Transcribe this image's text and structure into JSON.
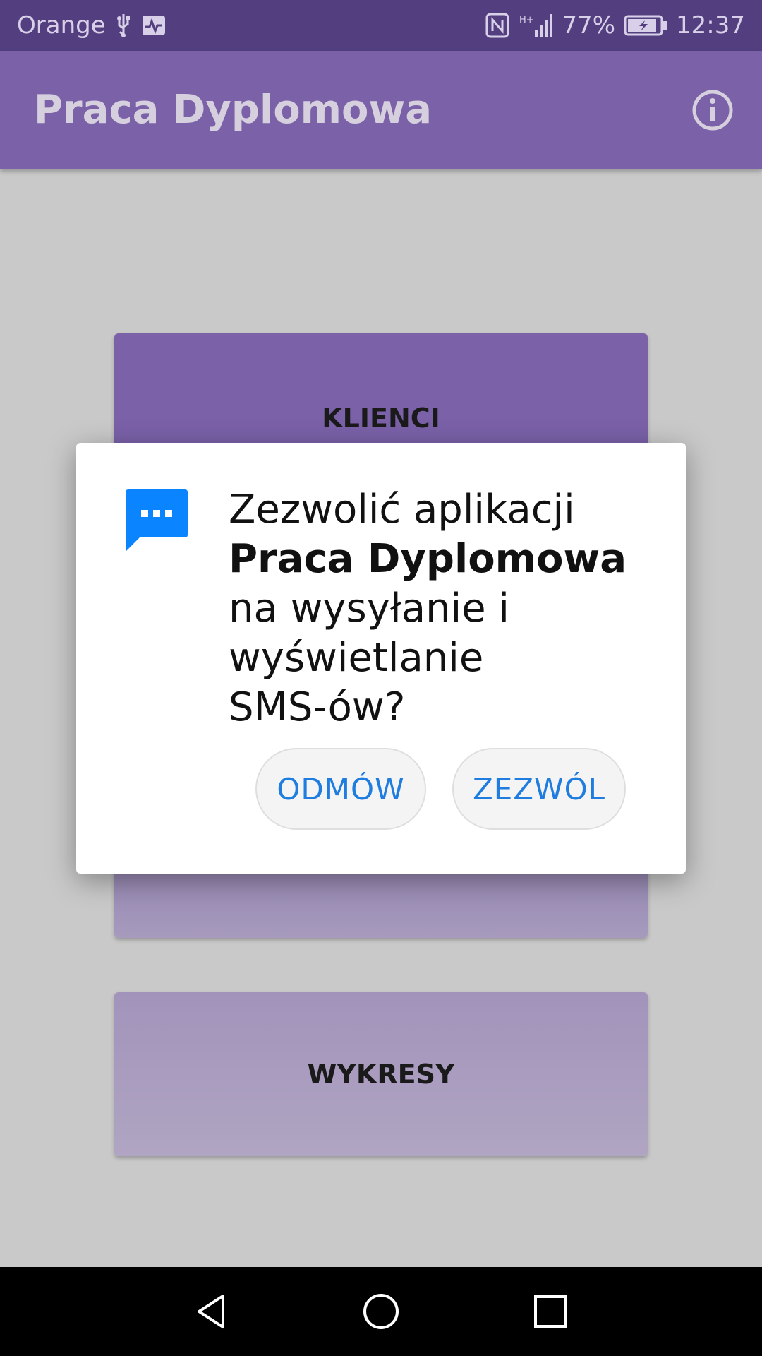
{
  "status_bar": {
    "carrier": "Orange",
    "battery": "77%",
    "time": "12:37",
    "icons": [
      "usb-icon",
      "activity-icon",
      "nfc-icon",
      "signal-icon",
      "battery-icon"
    ]
  },
  "app_bar": {
    "title": "Praca Dyplomowa",
    "info_icon": "info-icon"
  },
  "main": {
    "clients_label": "KLIENCI",
    "charts_label": "WYKRESY"
  },
  "dialog": {
    "line1": "Zezwolić aplikacji",
    "app_name": "Praca Dyplomowa",
    "line3": "na wysyłanie i",
    "line4": "wyświetlanie",
    "line5": "SMS-ów?",
    "deny_label": "ODMÓW",
    "allow_label": "ZEZWÓL",
    "icon": "sms-icon",
    "accent_color": "#1f7de0"
  },
  "nav_bar": {
    "icons": [
      "back-icon",
      "home-icon",
      "recents-icon"
    ]
  },
  "colors": {
    "status_bar": "#533f80",
    "app_bar": "#7a61a8",
    "sms_icon": "#0a84ff"
  }
}
